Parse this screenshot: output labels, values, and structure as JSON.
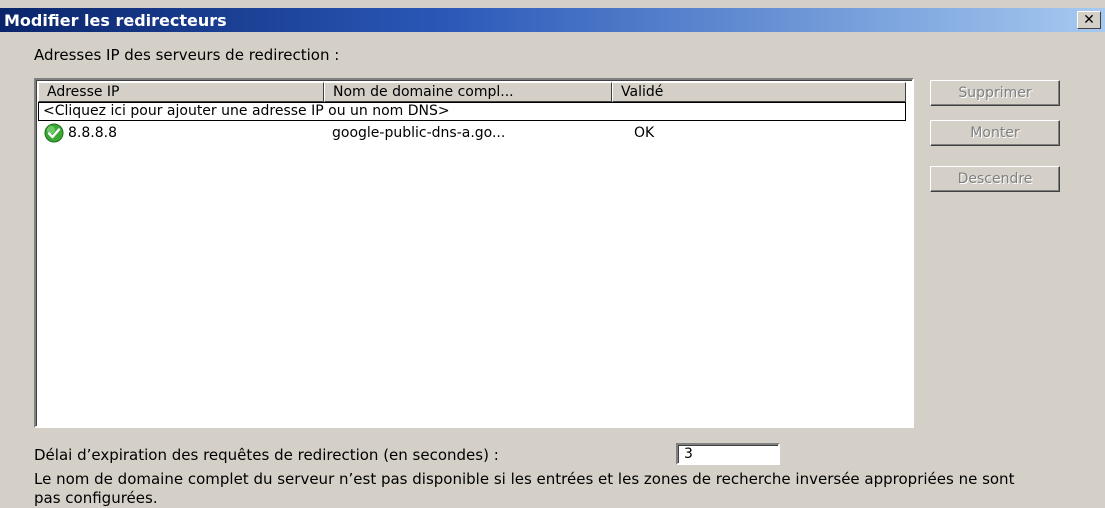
{
  "window": {
    "title": "Modifier les redirecteurs",
    "close_glyph": "✕"
  },
  "servers_label": "Adresses IP des serveurs de redirection :",
  "table": {
    "columns": [
      "Adresse IP",
      "Nom de domaine compl...",
      "Validé"
    ],
    "add_row_text": "<Cliquez ici pour ajouter une adresse IP ou un nom DNS>",
    "rows": [
      {
        "status_icon": "green-check-icon",
        "ip": "8.8.8.8",
        "fqdn": "google-public-dns-a.go...",
        "validated": "OK"
      }
    ]
  },
  "buttons": {
    "delete": "Supprimer",
    "move_up": "Monter",
    "move_down": "Descendre"
  },
  "timeout": {
    "label": "Délai d’expiration des requêtes de redirection (en secondes) :",
    "value": "3"
  },
  "note": "Le nom de domaine complet du serveur n’est pas disponible si les entrées et les zones de recherche inversée appropriées ne sont pas configurées.",
  "colors": {
    "window_bg": "#d4d0c8",
    "titlebar_start": "#0a246a",
    "titlebar_end": "#a6caf0",
    "ok_icon": "#3aa832"
  }
}
